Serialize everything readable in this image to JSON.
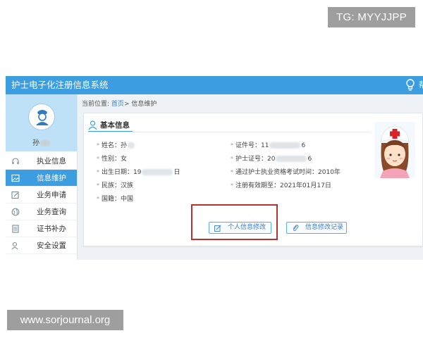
{
  "watermarks": {
    "top_right": "TG: MYYJJPP",
    "bottom_left": "www.sorjournal.org"
  },
  "app": {
    "title": "护士电子化注册信息系统",
    "topbar_cut_text": "帮"
  },
  "user": {
    "name_prefix": "孙"
  },
  "sidebar": {
    "items": [
      {
        "label": "执业信息",
        "icon": "headset-icon",
        "active": false
      },
      {
        "label": "信息维护",
        "icon": "image-icon",
        "active": true
      },
      {
        "label": "业务申请",
        "icon": "edit-icon",
        "active": false
      },
      {
        "label": "业务查询",
        "icon": "globe-icon",
        "active": false
      },
      {
        "label": "证书补办",
        "icon": "document-icon",
        "active": false
      },
      {
        "label": "安全设置",
        "icon": "user-lock-icon",
        "active": false
      }
    ]
  },
  "breadcrumb": {
    "prefix": "当前位置:",
    "home": "首页",
    "separator": ">",
    "current": "信息维护"
  },
  "card": {
    "title": "基本信息",
    "fields": {
      "name": {
        "label": "姓名：",
        "value": "孙"
      },
      "gender": {
        "label": "性别：",
        "value": "女"
      },
      "birth": {
        "label": "出生日期：",
        "value_start": "19",
        "value_end": "日"
      },
      "ethnicity": {
        "label": "民族：",
        "value": "汉族"
      },
      "nationality": {
        "label": "国籍：",
        "value": "中国"
      },
      "id_number": {
        "label": "证件号：",
        "value_start": "11",
        "value_end": "6"
      },
      "nurse_cert": {
        "label": "护士证号：",
        "value_start": "20",
        "value_end": "6"
      },
      "exam_time": {
        "label": "通过护士执业资格考试时间：",
        "value": "2010年"
      },
      "valid_until": {
        "label": "注册有效期至：",
        "value": "2021年01月17日"
      }
    }
  },
  "buttons": {
    "edit_info": "个人信息修改",
    "edit_log": "信息修改记录"
  },
  "colors": {
    "primary": "#3c9de0",
    "highlight_box": "#b3332f"
  }
}
